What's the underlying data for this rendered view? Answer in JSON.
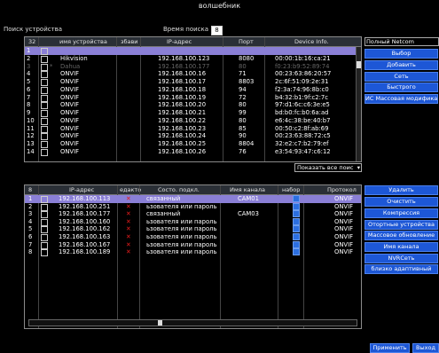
{
  "window": {
    "title": "волшебник"
  },
  "search": {
    "label": "Поиск устройства",
    "time_label": "Время поиска",
    "time_value": "8"
  },
  "top_table": {
    "headers": [
      "32",
      "имя устройства",
      "збави",
      "IP-адрес",
      "Порт",
      "Device Info."
    ],
    "rows": [
      {
        "no": "1",
        "name": "",
        "ip": "",
        "port": "",
        "info": "",
        "selected": true
      },
      {
        "no": "2",
        "name": "Hikvision",
        "ip": "192.168.100.123",
        "port": "8080",
        "info": "00:00:1b:16:ca:21"
      },
      {
        "no": "3",
        "name": "Dahua",
        "ip": "192.168.100.177",
        "port": "80",
        "info": "f0:23:b9:52:89:74",
        "dim": true,
        "mark": "*"
      },
      {
        "no": "4",
        "name": "ONVIF",
        "ip": "192.168.100.16",
        "port": "71",
        "info": "00:23:63:86:20:57"
      },
      {
        "no": "5",
        "name": "ONVIF",
        "ip": "192.168.100.17",
        "port": "8803",
        "info": "2c:6f:51:09:2e:31"
      },
      {
        "no": "6",
        "name": "ONVIF",
        "ip": "192.168.100.18",
        "port": "94",
        "info": "f2:3a:74:96:8b:c0"
      },
      {
        "no": "7",
        "name": "ONVIF",
        "ip": "192.168.100.19",
        "port": "72",
        "info": "b4:32:b1:9f:c2:7c"
      },
      {
        "no": "8",
        "name": "ONVIF",
        "ip": "192.168.100.20",
        "port": "80",
        "info": "97:d1:6c:c6:3e:e5"
      },
      {
        "no": "9",
        "name": "ONVIF",
        "ip": "192.168.100.21",
        "port": "99",
        "info": "bd:b0:fc:b0:6a:ad"
      },
      {
        "no": "10",
        "name": "ONVIF",
        "ip": "192.168.100.22",
        "port": "80",
        "info": "e6:4c:38:be:40:b7"
      },
      {
        "no": "11",
        "name": "ONVIF",
        "ip": "192.168.100.23",
        "port": "85",
        "info": "00:50:c2:8f:ab:69"
      },
      {
        "no": "12",
        "name": "ONVIF",
        "ip": "192.168.100.24",
        "port": "90",
        "info": "00:23:63:88:72:c5"
      },
      {
        "no": "13",
        "name": "ONVIF",
        "ip": "192.168.100.25",
        "port": "8804",
        "info": "32:e2:c7:b2:79:ef"
      },
      {
        "no": "14",
        "name": "ONVIF",
        "ip": "192.168.100.26",
        "port": "76",
        "info": "e3:54:93:47:c6:12"
      }
    ]
  },
  "right_panel": {
    "select_value": "Полный Netcom",
    "buttons": [
      "Выбор",
      "Добавить",
      "Сеть",
      "Быстрого",
      "ИС Массовая модифика"
    ]
  },
  "show_all": "Показать все поис",
  "bottom_table": {
    "headers": [
      "8",
      "IP-адрес",
      "едакто",
      "Состо. подкл.",
      "Имя канала",
      "набор",
      "Протокол"
    ],
    "rows": [
      {
        "no": "1",
        "ip": "192.168.100.113",
        "status": "связанный",
        "channel": "CAM01",
        "proto": "ONVIF",
        "selected": true
      },
      {
        "no": "2",
        "ip": "192.168.100.251",
        "status": "ьзователя или пароль",
        "channel": "",
        "proto": "ONVIF"
      },
      {
        "no": "3",
        "ip": "192.168.100.177",
        "status": "связанный",
        "channel": "CAM03",
        "proto": "ONVIF"
      },
      {
        "no": "4",
        "ip": "192.168.100.160",
        "status": "ьзователя или пароль",
        "channel": "",
        "proto": "ONVIF"
      },
      {
        "no": "5",
        "ip": "192.168.100.162",
        "status": "ьзователя или пароль",
        "channel": "",
        "proto": "ONVIF"
      },
      {
        "no": "6",
        "ip": "192.168.100.163",
        "status": "ьзователя или пароль",
        "channel": "",
        "proto": "ONVIF"
      },
      {
        "no": "7",
        "ip": "192.168.100.167",
        "status": "ьзователя или пароль",
        "channel": "",
        "proto": "ONVIF"
      },
      {
        "no": "8",
        "ip": "192.168.100.189",
        "status": "ьзователя или пароль",
        "channel": "",
        "proto": "ONVIF"
      }
    ]
  },
  "bottom_buttons": [
    "Удалить",
    "Очистить",
    "Компрессия",
    "Отортные устройства",
    "Массовое обновление",
    "Имя канала",
    "NVRСеть",
    "близко адаптивный"
  ],
  "footer": {
    "apply": "Применить",
    "exit": "Выход"
  },
  "colors": {
    "accent": "#1d57d6",
    "selected_row": "#8a7fd6",
    "error": "#e21c1c"
  }
}
